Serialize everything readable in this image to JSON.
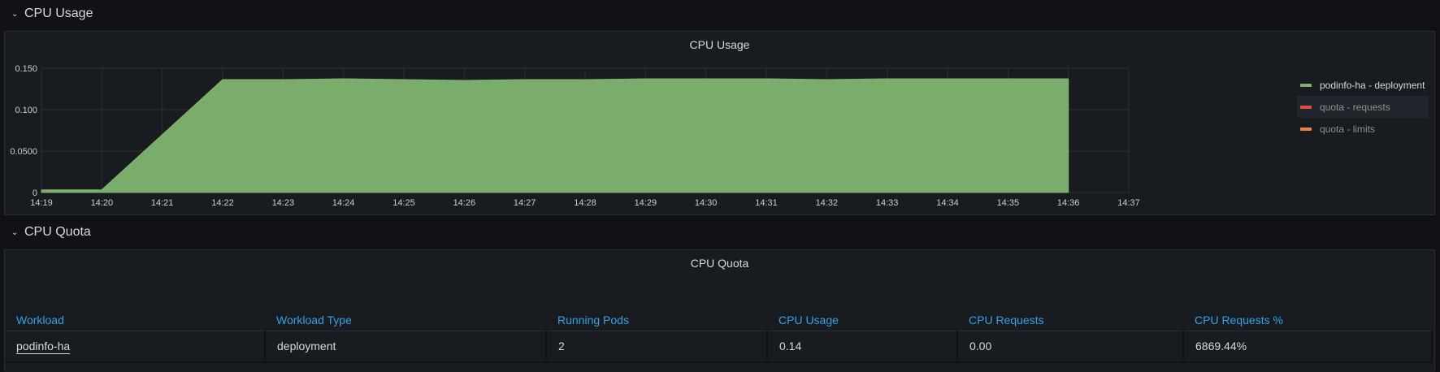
{
  "rows": {
    "cpu_usage_row": "CPU Usage",
    "cpu_quota_row": "CPU Quota"
  },
  "usage_panel": {
    "title": "CPU Usage"
  },
  "quota_panel": {
    "title": "CPU Quota"
  },
  "chart_data": {
    "type": "area",
    "title": "CPU Usage",
    "x_ticks": [
      "14:19",
      "14:20",
      "14:21",
      "14:22",
      "14:23",
      "14:24",
      "14:25",
      "14:26",
      "14:27",
      "14:28",
      "14:29",
      "14:30",
      "14:31",
      "14:32",
      "14:33",
      "14:34",
      "14:35",
      "14:36",
      "14:37"
    ],
    "y_ticks": [
      "0",
      "0.0500",
      "0.100",
      "0.150"
    ],
    "ylim": [
      0,
      0.15
    ],
    "xlim": [
      "14:19",
      "14:37"
    ],
    "grid": true,
    "legend_placement": "right",
    "series": [
      {
        "name": "podinfo-ha - deployment",
        "color": "#7eb26d",
        "x": [
          "14:19",
          "14:20",
          "14:22",
          "14:23",
          "14:24",
          "14:25",
          "14:26",
          "14:27",
          "14:28",
          "14:29",
          "14:30",
          "14:31",
          "14:32",
          "14:33",
          "14:34",
          "14:35",
          "14:36"
        ],
        "values": [
          0.003,
          0.003,
          0.136,
          0.136,
          0.137,
          0.136,
          0.135,
          0.136,
          0.136,
          0.137,
          0.137,
          0.137,
          0.136,
          0.137,
          0.137,
          0.137,
          0.137
        ]
      },
      {
        "name": "quota - requests",
        "color": "#e24d42",
        "x": [],
        "values": []
      },
      {
        "name": "quota - limits",
        "color": "#ef843c",
        "x": [],
        "values": []
      }
    ]
  },
  "legend": [
    {
      "label": "podinfo-ha - deployment",
      "color": "#7eb26d"
    },
    {
      "label": "quota - requests",
      "color": "#e24d42"
    },
    {
      "label": "quota - limits",
      "color": "#ef843c"
    }
  ],
  "table": {
    "columns": [
      "Workload",
      "Workload Type",
      "Running Pods",
      "CPU Usage",
      "CPU Requests",
      "CPU Requests %"
    ],
    "rows": [
      [
        "podinfo-ha",
        "deployment",
        "2",
        "0.14",
        "0.00",
        "6869.44%"
      ]
    ]
  }
}
